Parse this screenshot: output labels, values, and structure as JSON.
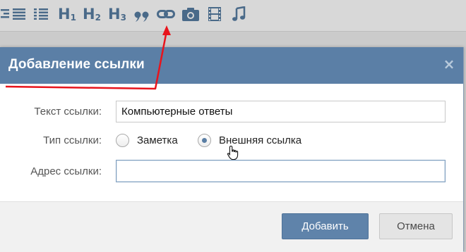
{
  "toolbar": {
    "icons": [
      "align-right-icon",
      "align-justify-icon",
      "list-icon",
      "heading-1-icon",
      "heading-2-icon",
      "heading-3-icon",
      "quote-icon",
      "link-icon",
      "camera-icon",
      "film-icon",
      "music-icon"
    ],
    "h1": {
      "main": "H",
      "sub": "1"
    },
    "h2": {
      "main": "H",
      "sub": "2"
    },
    "h3": {
      "main": "H",
      "sub": "3"
    },
    "quote": "❞"
  },
  "dialog": {
    "title": "Добавление ссылки",
    "close": "×",
    "text_label": "Текст ссылки:",
    "text_value": "Компьютерные ответы",
    "type_label": "Тип ссылки:",
    "options": [
      {
        "label": "Заметка",
        "checked": false
      },
      {
        "label": "Внешняя ссылка",
        "checked": true
      }
    ],
    "address_label": "Адрес ссылки:",
    "address_value": "",
    "add_button": "Добавить",
    "cancel_button": "Отмена"
  },
  "colors": {
    "header": "#5b7fa6",
    "toolbar_icon": "#4a6a89",
    "annotation": "#e8141c",
    "primary_button": "#5f83aa"
  }
}
